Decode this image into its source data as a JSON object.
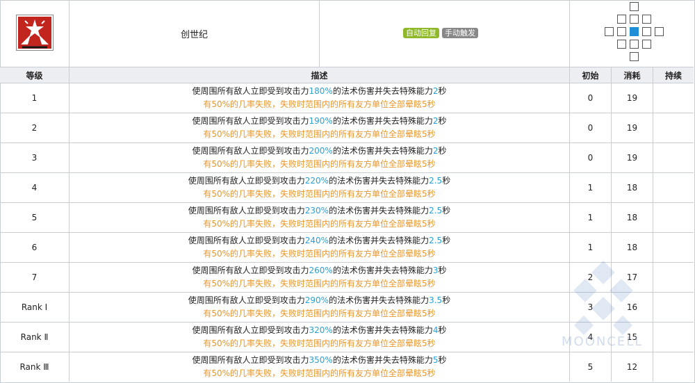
{
  "skill": {
    "icon": "skill-emblem-icon",
    "name": "创世纪",
    "tags": [
      "自动回复",
      "手动触发"
    ],
    "tag_colors": {
      "auto": "#8fb82a",
      "manual": "#888888"
    },
    "range_icon": "attack-range-grid-icon"
  },
  "table": {
    "headers": {
      "level": "等级",
      "desc": "描述",
      "init": "初始",
      "cost": "消耗",
      "duration": "持续"
    },
    "rows": [
      {
        "level": "1",
        "l1_pre": "使周围所有敌人立即受到攻击力",
        "pct": "180%",
        "l1_mid": "的法术伤害并失去特殊能力",
        "sec": "2",
        "l1_post": "秒",
        "line2": "有50%的几率失败，失败时范围内的所有友方单位全部晕眩5秒",
        "init": "0",
        "cost": "19",
        "duration": ""
      },
      {
        "level": "2",
        "l1_pre": "使周围所有敌人立即受到攻击力",
        "pct": "190%",
        "l1_mid": "的法术伤害并失去特殊能力",
        "sec": "2",
        "l1_post": "秒",
        "line2": "有50%的几率失败，失败时范围内的所有友方单位全部晕眩5秒",
        "init": "0",
        "cost": "19",
        "duration": ""
      },
      {
        "level": "3",
        "l1_pre": "使周围所有敌人立即受到攻击力",
        "pct": "200%",
        "l1_mid": "的法术伤害并失去特殊能力",
        "sec": "2",
        "l1_post": "秒",
        "line2": "有50%的几率失败，失败时范围内的所有友方单位全部晕眩5秒",
        "init": "0",
        "cost": "19",
        "duration": ""
      },
      {
        "level": "4",
        "l1_pre": "使周围所有敌人立即受到攻击力",
        "pct": "220%",
        "l1_mid": "的法术伤害并失去特殊能力",
        "sec": "2.5",
        "l1_post": "秒",
        "line2": "有50%的几率失败，失败时范围内的所有友方单位全部晕眩5秒",
        "init": "1",
        "cost": "18",
        "duration": ""
      },
      {
        "level": "5",
        "l1_pre": "使周围所有敌人立即受到攻击力",
        "pct": "230%",
        "l1_mid": "的法术伤害并失去特殊能力",
        "sec": "2.5",
        "l1_post": "秒",
        "line2": "有50%的几率失败，失败时范围内的所有友方单位全部晕眩5秒",
        "init": "1",
        "cost": "18",
        "duration": ""
      },
      {
        "level": "6",
        "l1_pre": "使周围所有敌人立即受到攻击力",
        "pct": "240%",
        "l1_mid": "的法术伤害并失去特殊能力",
        "sec": "2.5",
        "l1_post": "秒",
        "line2": "有50%的几率失败，失败时范围内的所有友方单位全部晕眩5秒",
        "init": "1",
        "cost": "18",
        "duration": ""
      },
      {
        "level": "7",
        "l1_pre": "使周围所有敌人立即受到攻击力",
        "pct": "260%",
        "l1_mid": "的法术伤害并失去特殊能力",
        "sec": "3",
        "l1_post": "秒",
        "line2": "有50%的几率失败，失败时范围内的所有友方单位全部晕眩5秒",
        "init": "2",
        "cost": "17",
        "duration": ""
      },
      {
        "level": "Rank Ⅰ",
        "l1_pre": "使周围所有敌人立即受到攻击力",
        "pct": "290%",
        "l1_mid": "的法术伤害并失去特殊能力",
        "sec": "3.5",
        "l1_post": "秒",
        "line2": "有50%的几率失败，失败时范围内的所有友方单位全部晕眩5秒",
        "init": "3",
        "cost": "16",
        "duration": ""
      },
      {
        "level": "Rank Ⅱ",
        "l1_pre": "使周围所有敌人立即受到攻击力",
        "pct": "320%",
        "l1_mid": "的法术伤害并失去特殊能力",
        "sec": "4",
        "l1_post": "秒",
        "line2": "有50%的几率失败，失败时范围内的所有友方单位全部晕眩5秒",
        "init": "4",
        "cost": "15",
        "duration": ""
      },
      {
        "level": "Rank Ⅲ",
        "l1_pre": "使周围所有敌人立即受到攻击力",
        "pct": "350%",
        "l1_mid": "的法术伤害并失去特殊能力",
        "sec": "5",
        "l1_post": "秒",
        "line2": "有50%的几率失败，失败时范围内的所有友方单位全部晕眩5秒",
        "init": "5",
        "cost": "12",
        "duration": ""
      }
    ]
  },
  "watermark": {
    "text": "MOONCELL",
    "icon": "mooncell-watermark-icon"
  },
  "colors": {
    "highlight": "#2aa0d8",
    "warning": "#e8962a",
    "border": "#c8ccd3",
    "header_bg": "#eceef2",
    "range_self": "#1e8fd6"
  }
}
